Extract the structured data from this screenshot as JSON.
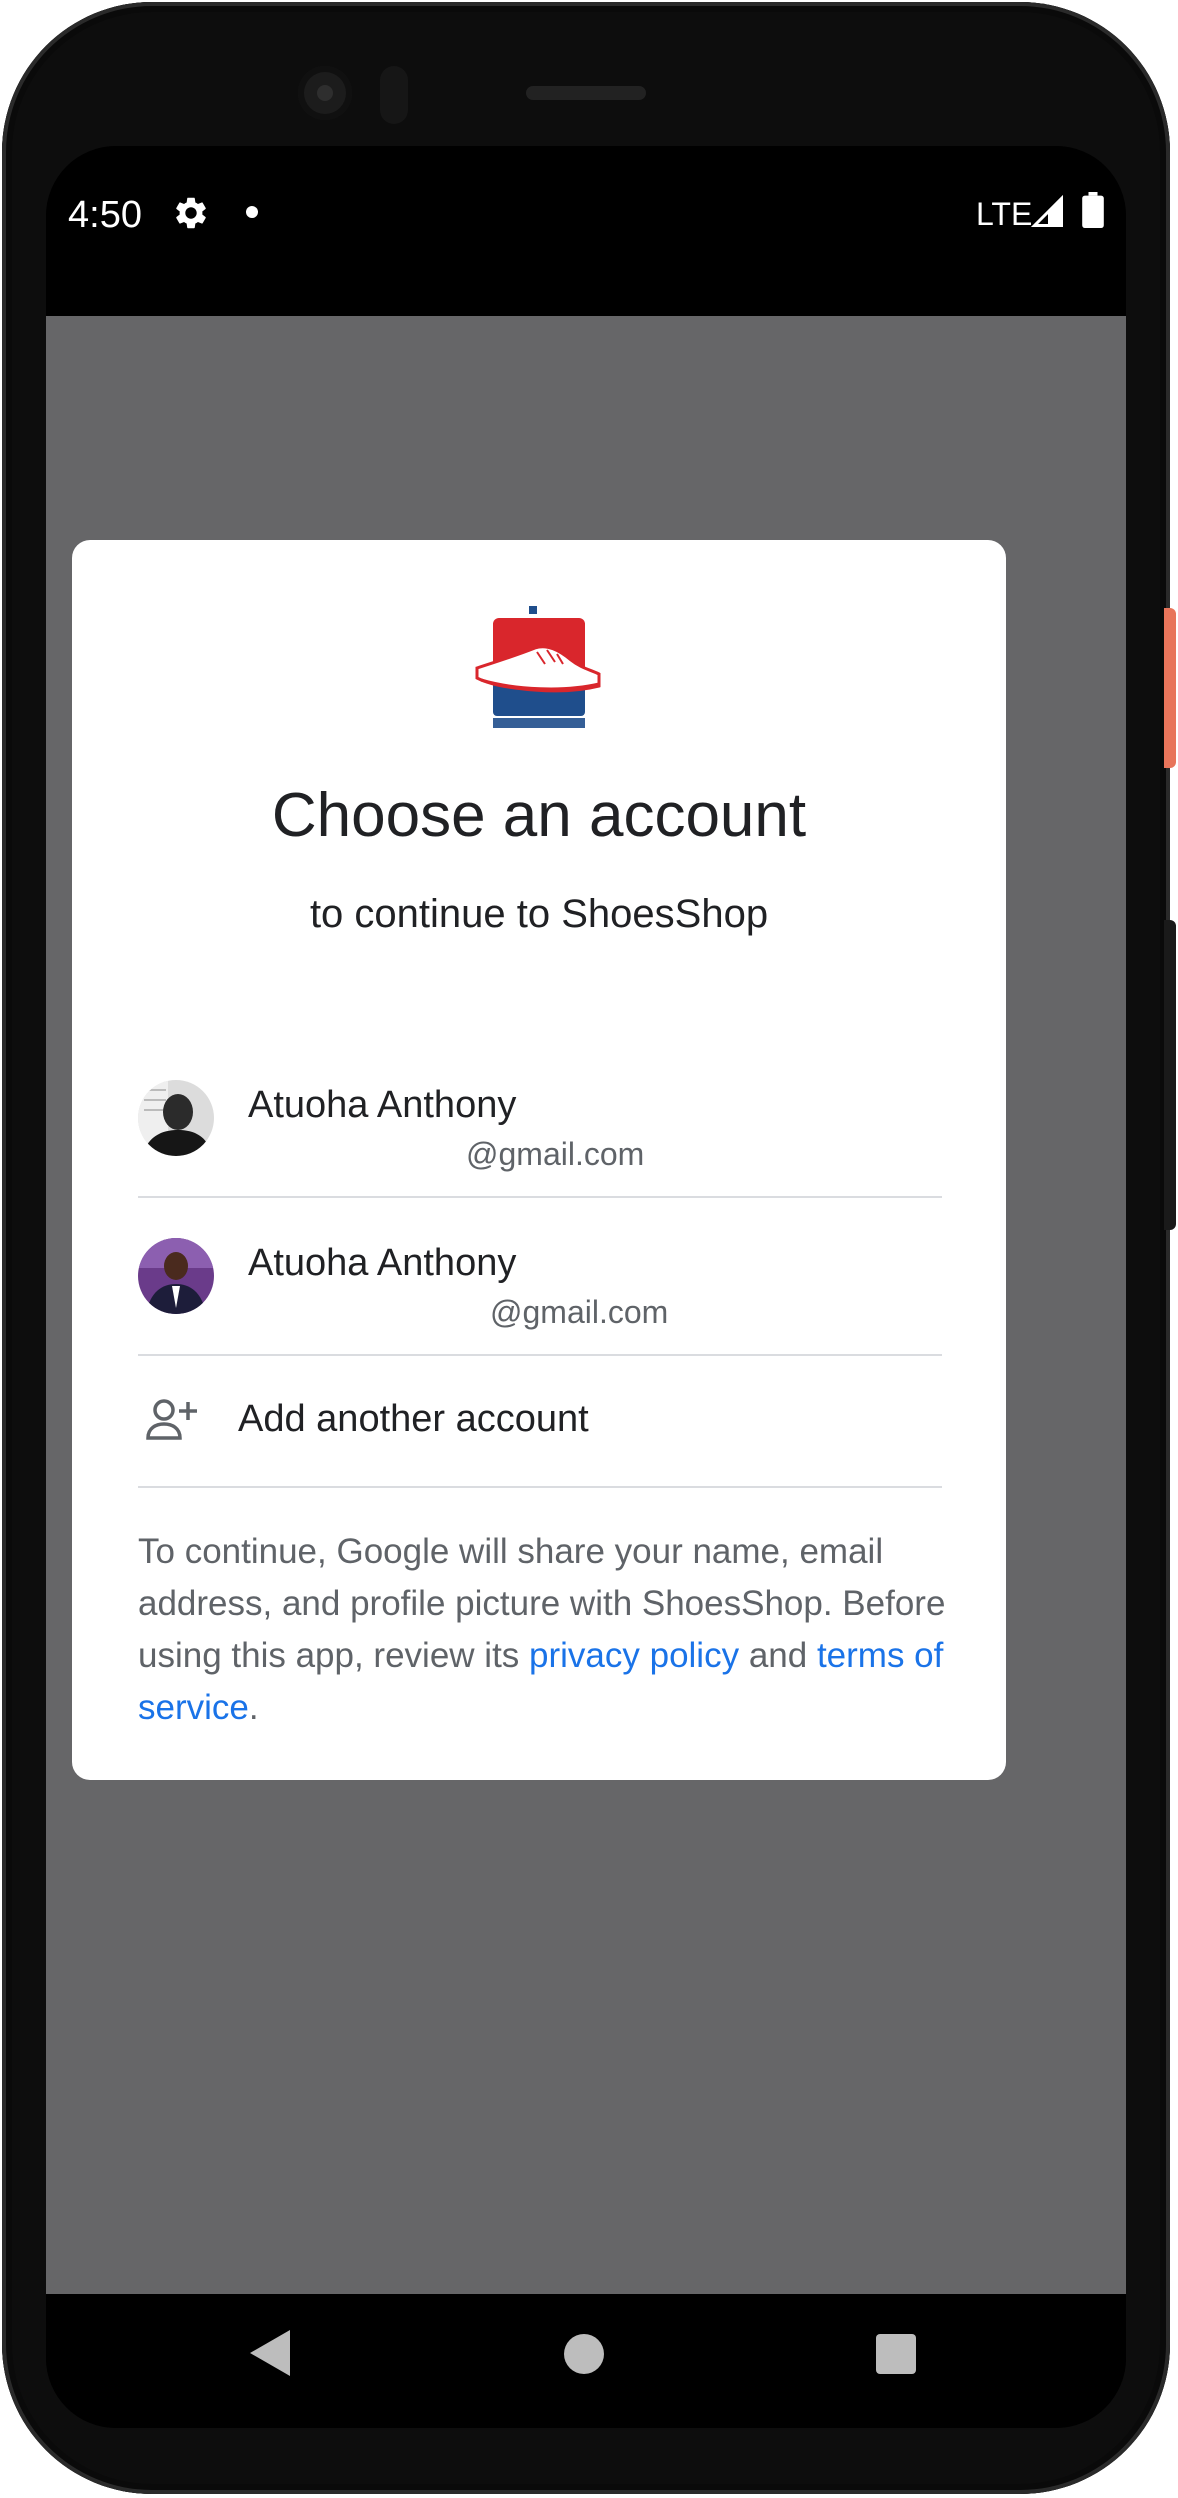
{
  "status_bar": {
    "time": "4:50",
    "network": "LTE",
    "icons": [
      "settings-icon",
      "notification-dot-icon",
      "signal-icon",
      "battery-icon"
    ]
  },
  "dialog": {
    "title": "Choose an account",
    "subtitle": "to continue to ShoesShop",
    "accounts": [
      {
        "name": "Atuoha Anthony",
        "email": "@gmail.com"
      },
      {
        "name": "Atuoha Anthony",
        "email": "@gmail.com"
      }
    ],
    "add_account_label": "Add another account",
    "consent": {
      "text_part1": "To continue, Google will share your name, email address, and profile picture with ShoesShop. Before using this app, review its ",
      "privacy_policy": "privacy policy",
      "text_and": " and ",
      "terms_of_service": "terms of service",
      "text_end": "."
    }
  },
  "nav_bar": {
    "icons": [
      "back-icon",
      "home-icon",
      "recents-icon"
    ]
  },
  "colors": {
    "scrim": "#666668",
    "link": "#1a73e8",
    "text_primary": "#202124",
    "text_secondary": "#5f6368",
    "divider": "#dadce0",
    "logo_red": "#d9262c",
    "logo_blue": "#1f4e8c"
  }
}
